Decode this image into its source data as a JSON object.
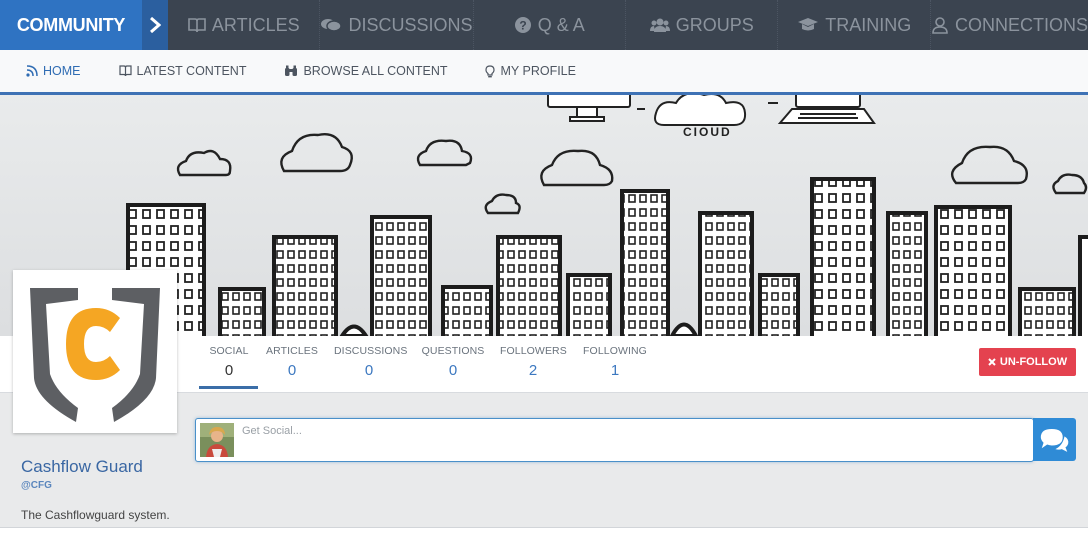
{
  "topnav": {
    "brand": "COMMUNITY",
    "items": [
      {
        "label": "ARTICLES",
        "icon": "book-icon"
      },
      {
        "label": "DISCUSSIONS",
        "icon": "comments-icon"
      },
      {
        "label": "Q & A",
        "icon": "question-circle-icon"
      },
      {
        "label": "GROUPS",
        "icon": "users-icon"
      },
      {
        "label": "TRAINING",
        "icon": "graduation-cap-icon"
      },
      {
        "label": "CONNECTIONS",
        "icon": "user-icon"
      }
    ]
  },
  "subnav": {
    "items": [
      {
        "label": "HOME",
        "icon": "rss-icon",
        "active": true
      },
      {
        "label": "LATEST CONTENT",
        "icon": "book-icon"
      },
      {
        "label": "BROWSE ALL CONTENT",
        "icon": "binoculars-icon"
      },
      {
        "label": "MY PROFILE",
        "icon": "lightbulb-icon"
      }
    ]
  },
  "banner": {
    "cloud_label": "CIOUD"
  },
  "stats": [
    {
      "label": "SOCIAL",
      "value": "0"
    },
    {
      "label": "ARTICLES",
      "value": "0"
    },
    {
      "label": "DISCUSSIONS",
      "value": "0"
    },
    {
      "label": "QUESTIONS",
      "value": "0"
    },
    {
      "label": "FOLLOWERS",
      "value": "2"
    },
    {
      "label": "FOLLOWING",
      "value": "1"
    }
  ],
  "actions": {
    "unfollow_label": "UN-FOLLOW"
  },
  "profile": {
    "name": "Cashflow Guard",
    "handle": "@CFG",
    "bio": "The Cashflowguard system.",
    "logo_letter": "C"
  },
  "composer": {
    "placeholder": "Get Social..."
  },
  "colors": {
    "brand_blue": "#2f73c2",
    "nav_dark": "#3b4450",
    "unfollow_red": "#e4424f",
    "logo_orange": "#f5a623",
    "logo_gray": "#5d5f63"
  }
}
